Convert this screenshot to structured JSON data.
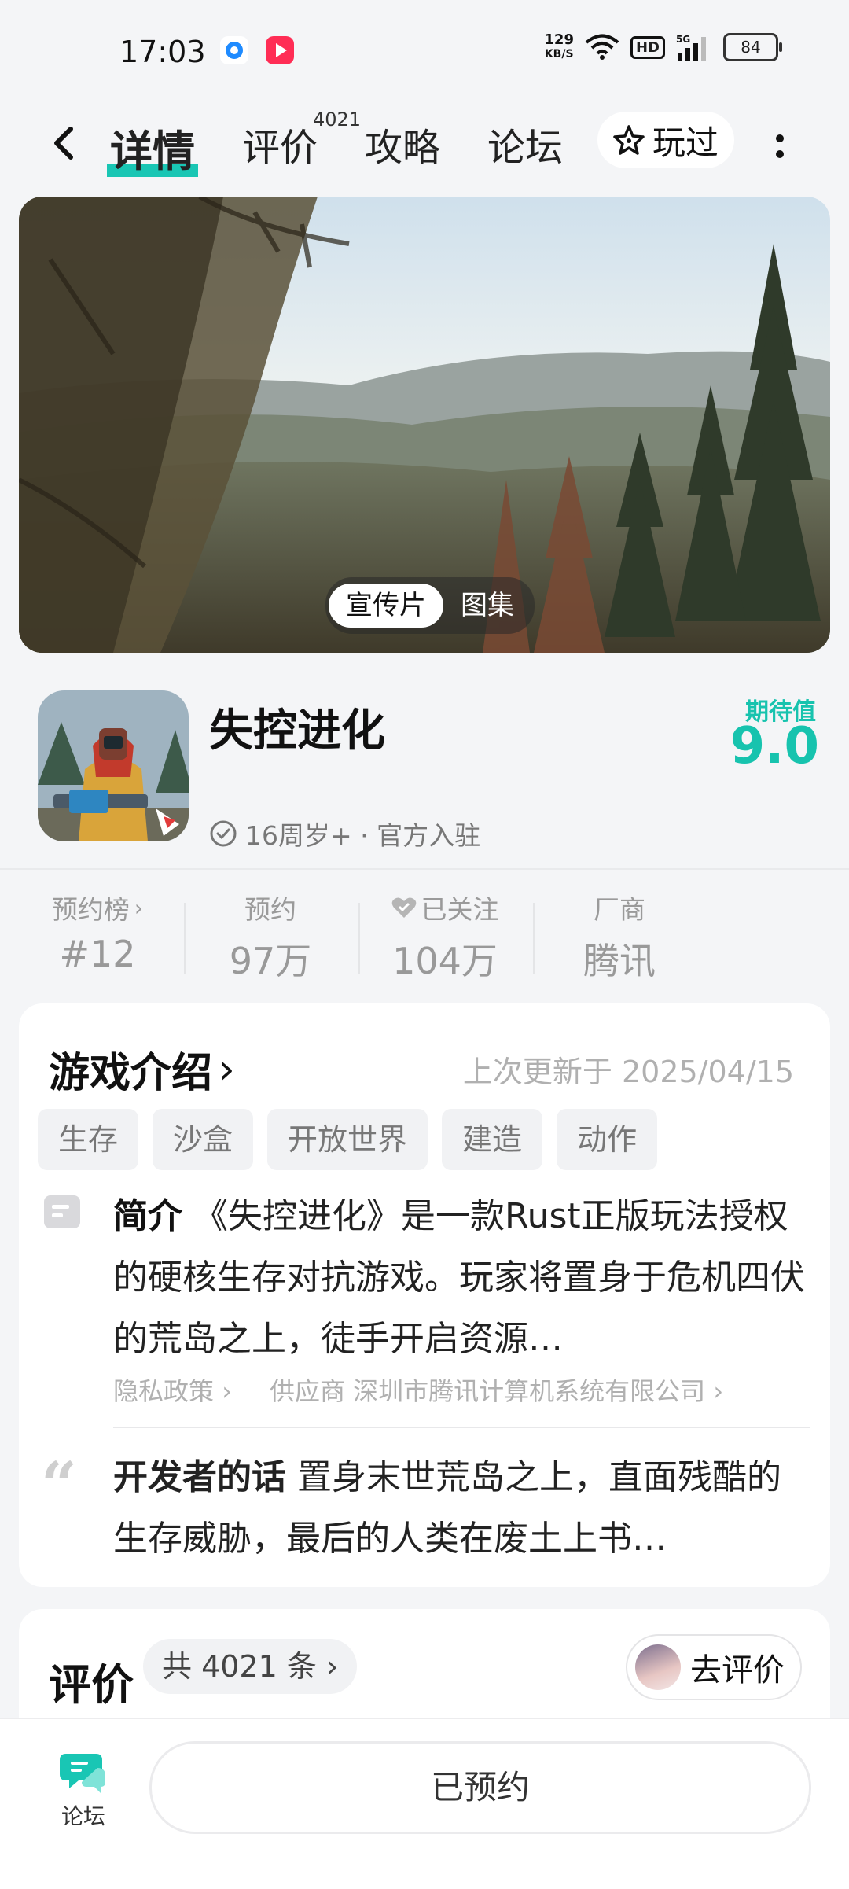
{
  "status_bar": {
    "time": "17:03",
    "net_speed_value": "129",
    "net_speed_unit": "KB/S",
    "hd": "HD",
    "network": "5G",
    "battery": "84"
  },
  "nav": {
    "tabs": [
      "详情",
      "评价",
      "攻略",
      "论坛"
    ],
    "review_count": "4021",
    "played_label": "玩过"
  },
  "banner": {
    "tabs": [
      "宣传片",
      "图集"
    ]
  },
  "game": {
    "title": "失控进化",
    "meta": "16周岁+ · 官方入驻",
    "expect_label": "期待值",
    "expect_score": "9.0"
  },
  "stats": [
    {
      "label": "预约榜",
      "value": "#12"
    },
    {
      "label": "预约",
      "value": "97万"
    },
    {
      "label": "已关注",
      "value": "104万"
    },
    {
      "label": "厂商",
      "value": "腾讯"
    }
  ],
  "intro": {
    "title": "游戏介绍",
    "updated": "上次更新于 2025/04/15",
    "tags": [
      "生存",
      "沙盒",
      "开放世界",
      "建造",
      "动作"
    ],
    "summary_label": "简介",
    "summary": " 《失控进化》是一款Rust正版玩法授权的硬核生存对抗游戏。玩家将置身于危机四伏的荒岛之上，徒手开启资源…",
    "privacy_link": "隐私政策",
    "supplier": "供应商 深圳市腾讯计算机系统有限公司",
    "dev_label": "开发者的话",
    "dev_text": " 置身末世荒岛之上，直面残酷的生存威胁，最后的人类在废土上书…"
  },
  "review": {
    "title": "评价",
    "count": "共 4021 条",
    "write_label": "去评价"
  },
  "bottom": {
    "forum_label": "论坛",
    "reserve_label": "已预约"
  },
  "colors": {
    "accent": "#19c6b4",
    "background": "#f4f5f7"
  }
}
